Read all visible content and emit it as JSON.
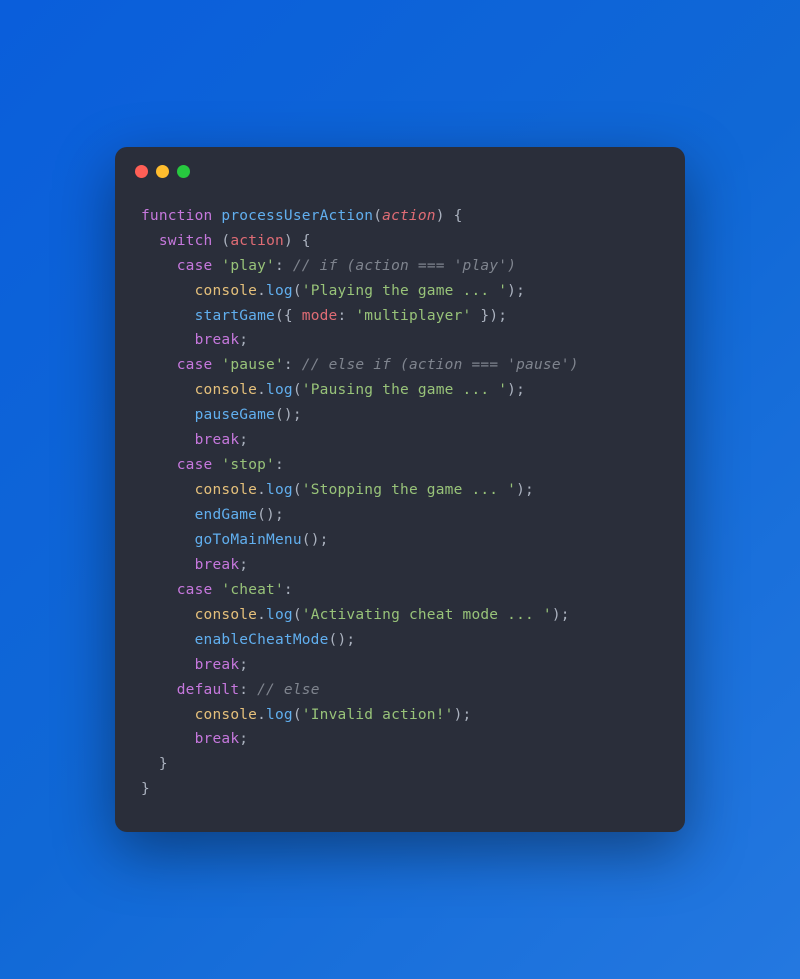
{
  "code": {
    "l1": {
      "kw1": "function",
      "fn": "processUserAction",
      "p1": "(",
      "param": "action",
      "p2": ")",
      "p3": " {"
    },
    "l2": {
      "kw": "switch",
      "p1": " (",
      "var": "action",
      "p2": ") {"
    },
    "l3": {
      "kw": "case",
      "sp": " ",
      "str": "'play'",
      "colon": ":",
      "sp2": " ",
      "com": "// if (action === 'play')"
    },
    "l4": {
      "obj": "console",
      "dot": ".",
      "fn": "log",
      "p1": "(",
      "str": "'Playing the game ... '",
      "p2": ");"
    },
    "l5": {
      "fn": "startGame",
      "p1": "({ ",
      "prop": "mode",
      "colon": ":",
      "sp": " ",
      "str": "'multiplayer'",
      "p2": " });"
    },
    "l6": {
      "kw": "break",
      "p": ";"
    },
    "l7": {
      "kw": "case",
      "sp": " ",
      "str": "'pause'",
      "colon": ":",
      "sp2": " ",
      "com": "// else if (action === 'pause')"
    },
    "l8": {
      "obj": "console",
      "dot": ".",
      "fn": "log",
      "p1": "(",
      "str": "'Pausing the game ... '",
      "p2": ");"
    },
    "l9": {
      "fn": "pauseGame",
      "p": "();"
    },
    "l10": {
      "kw": "break",
      "p": ";"
    },
    "l11": {
      "kw": "case",
      "sp": " ",
      "str": "'stop'",
      "colon": ":"
    },
    "l12": {
      "obj": "console",
      "dot": ".",
      "fn": "log",
      "p1": "(",
      "str": "'Stopping the game ... '",
      "p2": ");"
    },
    "l13": {
      "fn": "endGame",
      "p": "();"
    },
    "l14": {
      "fn": "goToMainMenu",
      "p": "();"
    },
    "l15": {
      "kw": "break",
      "p": ";"
    },
    "l16": {
      "kw": "case",
      "sp": " ",
      "str": "'cheat'",
      "colon": ":"
    },
    "l17": {
      "obj": "console",
      "dot": ".",
      "fn": "log",
      "p1": "(",
      "str": "'Activating cheat mode ... '",
      "p2": ");"
    },
    "l18": {
      "fn": "enableCheatMode",
      "p": "();"
    },
    "l19": {
      "kw": "break",
      "p": ";"
    },
    "l20": {
      "kw": "default",
      "colon": ":",
      "sp": " ",
      "com": "// else"
    },
    "l21": {
      "obj": "console",
      "dot": ".",
      "fn": "log",
      "p1": "(",
      "str": "'Invalid action!'",
      "p2": ");"
    },
    "l22": {
      "kw": "break",
      "p": ";"
    },
    "l23": {
      "p": "}"
    },
    "l24": {
      "p": "}"
    }
  }
}
